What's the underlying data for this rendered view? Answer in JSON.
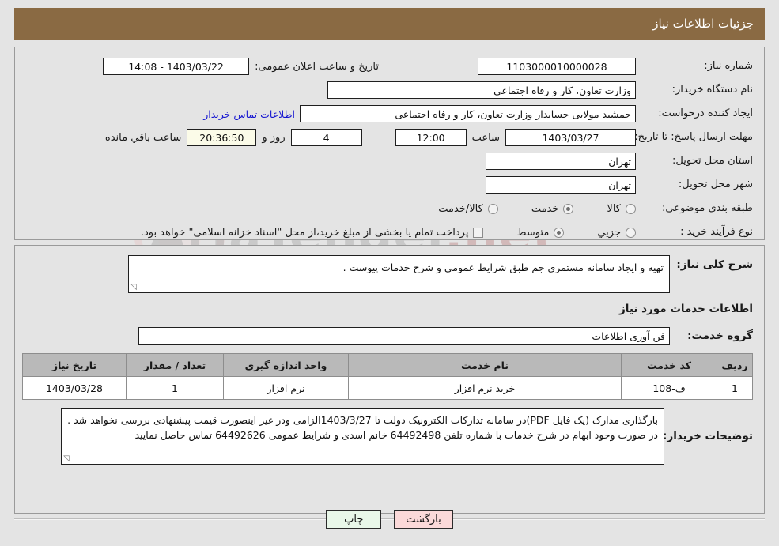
{
  "header": {
    "title": "جزئیات اطلاعات نیاز",
    "bar_color": "#8a6a43"
  },
  "watermark": {
    "text": "AriaTender",
    "suffix": ".net"
  },
  "details": {
    "need_number_label": "شماره نیاز:",
    "need_number_value": "1103000010000028",
    "announce_label": "تاریخ و ساعت اعلان عمومی:",
    "announce_value": "1403/03/22 - 14:08",
    "buyer_org_label": "نام دستگاه خریدار:",
    "buyer_org_value": "وزارت تعاون، کار و رفاه اجتماعی",
    "creator_label": "ایجاد کننده درخواست:",
    "creator_value": "جمشید مولایی حسابدار وزارت تعاون، کار و رفاه اجتماعی",
    "contact_link": "اطلاعات تماس خریدار",
    "deadline_label": "مهلت ارسال پاسخ: تا تاریخ:",
    "deadline_date": "1403/03/27",
    "deadline_time_label": "ساعت",
    "deadline_time": "12:00",
    "remaining_days": "4",
    "remaining_days_label": "روز و",
    "remaining_clock": "20:36:50",
    "remaining_clock_label": "ساعت باقي مانده",
    "province_label": "استان محل تحویل:",
    "province_value": "تهران",
    "city_label": "شهر محل تحویل:",
    "city_value": "تهران",
    "category_label": "طبقه بندی موضوعی:",
    "category_options": [
      {
        "label": "کالا",
        "selected": false
      },
      {
        "label": "خدمت",
        "selected": true
      },
      {
        "label": "کالا/خدمت",
        "selected": false
      }
    ],
    "process_label": "نوع فرآیند خرید :",
    "process_options": [
      {
        "label": "جزیي",
        "selected": false
      },
      {
        "label": "متوسط",
        "selected": true
      }
    ],
    "treasury_checkbox_checked": false,
    "treasury_note": "پرداخت تمام یا بخشی از مبلغ خرید،از محل \"اسناد خزانه اسلامی\" خواهد بود."
  },
  "body": {
    "description_label": "شرح کلی نیاز:",
    "description_value": "تهیه و ایجاد سامانه مستمری جم طبق شرایط عمومی و شرح خدمات پیوست .",
    "services_section_title": "اطلاعات خدمات مورد نیاز",
    "service_group_label": "گروه خدمت:",
    "service_group_value": "فن آوری اطلاعات",
    "notes_label": "توضیحات خریدار:",
    "notes_value": "بارگذاری مدارک (یک فایل PDF)در سامانه تدارکات الکترونیک دولت تا 1403/3/27الزامی ودر غیر اینصورت قیمت پیشنهادی بررسی نخواهد شد . در صورت وجود ابهام در شرح خدمات با شماره تلفن 64492498 خانم اسدی و شرایط عمومی 64492626 تماس حاصل نمایید"
  },
  "table": {
    "columns": [
      "ردیف",
      "کد خدمت",
      "نام خدمت",
      "واحد اندازه گیری",
      "تعداد / مقدار",
      "تاریخ نیاز"
    ],
    "rows": [
      {
        "radif": "1",
        "code": "ف-108",
        "name": "خرید نرم افزار",
        "unit": "نرم افزار",
        "qty": "1",
        "date": "1403/03/28"
      }
    ]
  },
  "footer": {
    "print_label": "چاپ",
    "back_label": "بازگشت",
    "print_color": "#e9f7e9",
    "back_color": "#fbd9d9"
  }
}
